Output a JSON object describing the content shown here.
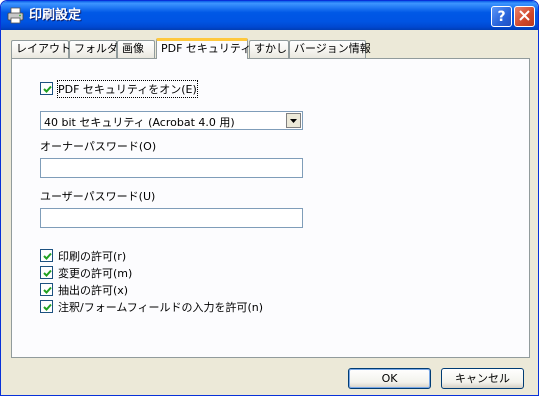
{
  "window": {
    "title": "印刷設定",
    "help_label": "?",
    "close_label": "✕"
  },
  "tabs": [
    {
      "label": "レイアウト"
    },
    {
      "label": "フォルダ"
    },
    {
      "label": "画像"
    },
    {
      "label": "PDF セキュリティ",
      "active": true
    },
    {
      "label": "すかし"
    },
    {
      "label": "バージョン情報"
    }
  ],
  "security": {
    "enable_label": "PDF セキュリティをオン(E)",
    "enable_checked": true,
    "encryption_selected": "40 bit セキュリティ (Acrobat 4.0 用)",
    "owner_password_label": "オーナーパスワード(O)",
    "owner_password_value": "",
    "user_password_label": "ユーザーパスワード(U)",
    "user_password_value": "",
    "permissions": [
      {
        "label": "印刷の許可(r)",
        "checked": true
      },
      {
        "label": "変更の許可(m)",
        "checked": true
      },
      {
        "label": "抽出の許可(x)",
        "checked": true
      },
      {
        "label": "注釈/フォームフィールドの入力を許可(n)",
        "checked": true
      }
    ]
  },
  "buttons": {
    "ok_label": "OK",
    "cancel_label": "キャンセル"
  },
  "colors": {
    "titlebar": "#0054E3",
    "dialog_bg": "#ECE9D8",
    "active_tab_accent": "#FFC83C",
    "checkmark": "#21A121"
  },
  "icons": {
    "app": "printer-icon",
    "help": "help-icon",
    "close": "close-icon",
    "dropdown": "chevron-down-icon",
    "check": "checkmark-icon"
  }
}
